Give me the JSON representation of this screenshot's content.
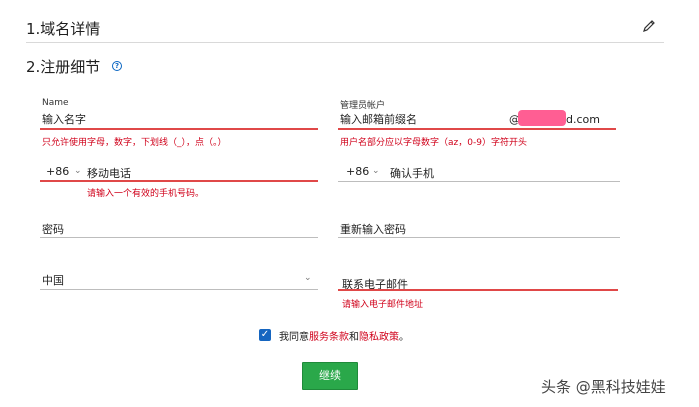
{
  "section1": {
    "title": "1.域名详情"
  },
  "section2": {
    "title": "2.注册细节",
    "help_icon": "question-icon"
  },
  "name": {
    "label": "Name",
    "placeholder": "输入名字",
    "error": "只允许使用字母，数字，下划线（_），点（。）"
  },
  "admin": {
    "label": "管理员帐户",
    "placeholder": "输入邮箱前缀名",
    "domain_prefix": "@",
    "domain_suffix": "d.com",
    "error": "用户名部分应以字母数字（az，0-9）字符开头"
  },
  "mobile": {
    "country_code": "+86",
    "placeholder": "移动电话",
    "error": "请输入一个有效的手机号码。"
  },
  "confirm_mobile": {
    "country_code": "+86",
    "placeholder": "确认手机"
  },
  "password": {
    "placeholder": "密码"
  },
  "password_confirm": {
    "placeholder": "重新输入密码"
  },
  "country": {
    "value": "中国"
  },
  "contact_email": {
    "placeholder": "联系电子邮件",
    "error": "请输入电子邮件地址"
  },
  "agreement": {
    "prefix": "我同意",
    "terms": "服务条款",
    "and": "和",
    "privacy": "隐私政策",
    "suffix": "。",
    "checked": true
  },
  "continue_button": {
    "label": "继续"
  },
  "watermark": "头条 @黑科技娃娃",
  "colors": {
    "error_red": "#d0021b",
    "button_green": "#2aa84a",
    "checkbox_blue": "#1565c0",
    "redact_pink": "#ff5e93"
  }
}
